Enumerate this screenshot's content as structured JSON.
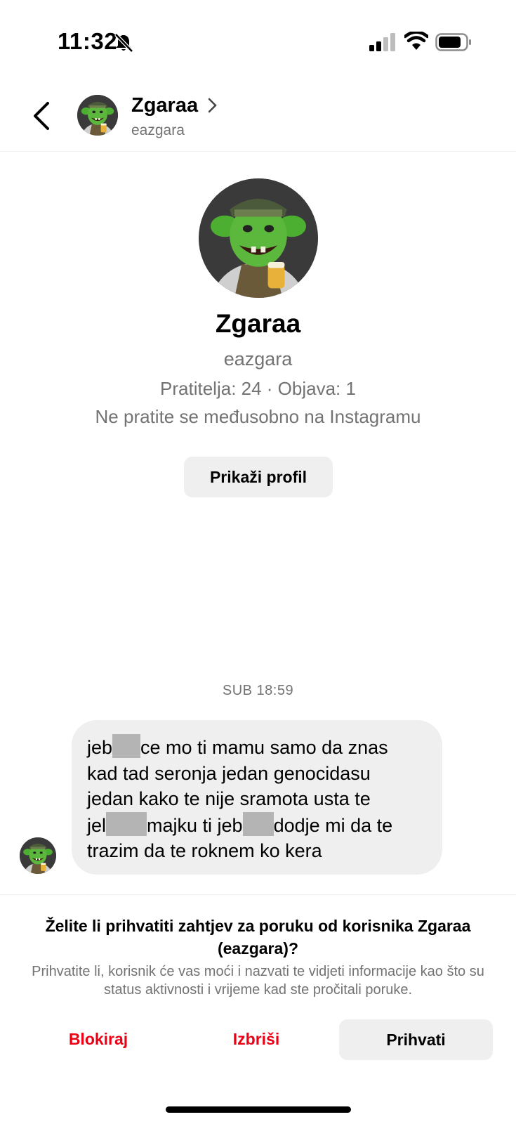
{
  "status_bar": {
    "time": "11:32",
    "icons": [
      "bell-slash-icon",
      "cellular-signal-icon",
      "wifi-icon",
      "battery-icon"
    ]
  },
  "header": {
    "name": "Zgaraa",
    "username": "eazgara"
  },
  "profile": {
    "name": "Zgaraa",
    "username": "eazgara",
    "stats": "Pratitelja: 24 · Objava: 1",
    "mutual_note": "Ne pratite se međusobno na Instagramu",
    "view_profile_label": "Prikaži profil"
  },
  "conversation": {
    "timestamp": "SUB 18:59",
    "message_lines": [
      [
        "jeb",
        "ce mo ti mamu samo da znas"
      ],
      [
        "kad tad seronja jedan genocidasu"
      ],
      [
        "jedan kako te nije sramota usta te"
      ],
      [
        "jel",
        "majku ti jeb",
        "dodje mi da te"
      ],
      [
        "trazim da te roknem ko kera"
      ]
    ]
  },
  "request": {
    "question": "Želite li prihvatiti zahtjev za poruku od korisnika Zgaraa (eazgara)?",
    "info": "Prihvatite li, korisnik će vas moći i nazvati te vidjeti informacije kao što su status aktivnosti i vrijeme kad ste pročitali poruke.",
    "block_label": "Blokiraj",
    "delete_label": "Izbriši",
    "accept_label": "Prihvati"
  },
  "colors": {
    "destructive": "#ed0015",
    "secondary_text": "#737373",
    "bubble_bg": "#efefef",
    "button_bg": "#efefef"
  }
}
